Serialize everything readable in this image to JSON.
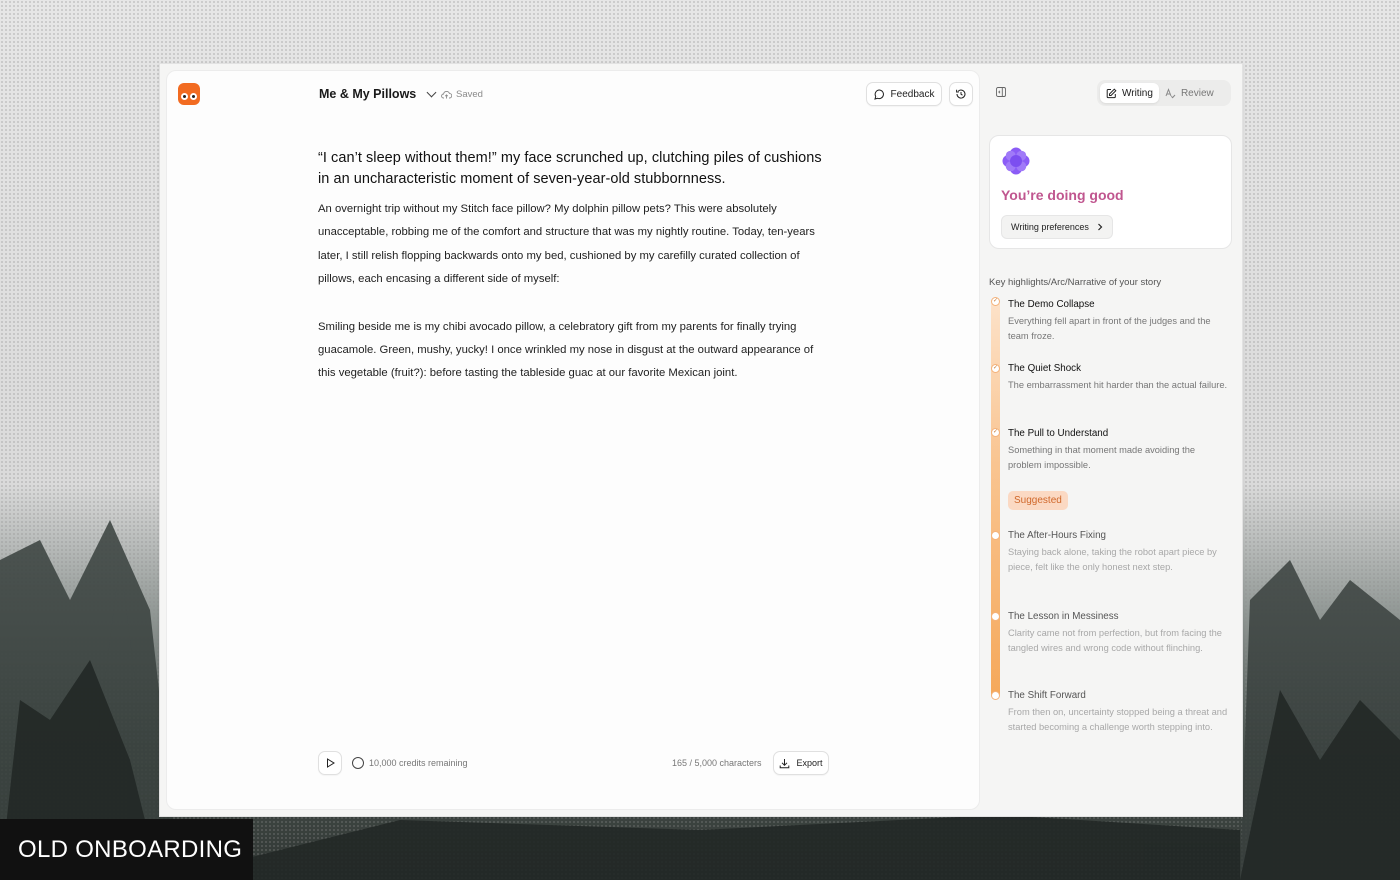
{
  "header": {
    "doc_title": "Me & My Pillows",
    "save_status": "Saved",
    "feedback_label": "Feedback"
  },
  "document": {
    "heading": "“I can’t sleep without them!” my face scrunched up, clutching piles of cushions in an uncharacteristic moment of seven-year-old stubbornness.",
    "paragraphs": [
      "An overnight trip without my Stitch face pillow? My dolphin pillow pets?  This were absolutely unacceptable, robbing me of the comfort and structure that was my nightly routine. Today, ten-years later, I still relish flopping backwards onto my bed, cushioned by my carefilly curated collection of pillows, each encasing a different side of myself:",
      "Smiling beside me is my chibi avocado pillow, a celebratory gift from my parents for finally trying guacamole. Green, mushy, yucky! I once wrinkled my nose in disgust at the outward appearance of this vegetable (fruit?): before tasting the tableside guac at our favorite Mexican joint."
    ]
  },
  "footer": {
    "credits": "10,000 credits remaining",
    "char_count": "165 / 5,000 characters",
    "export_label": "Export"
  },
  "sidebar": {
    "tabs": [
      {
        "label": "Writing",
        "active": true,
        "icon": "edit-icon"
      },
      {
        "label": "Review",
        "active": false,
        "icon": "review-icon"
      }
    ],
    "status_title": "You’re doing good",
    "preferences_label": "Writing preferences",
    "highlights_title": "Key highlights/Arc/Narrative of your story",
    "suggested_label": "Suggested",
    "completed_items": [
      {
        "title": "The Demo Collapse",
        "desc": "Everything fell apart in front of the judges and the team froze."
      },
      {
        "title": "The Quiet Shock",
        "desc": "The embarrassment hit harder than the actual failure."
      },
      {
        "title": "The Pull to Understand",
        "desc": "Something in that moment made avoiding the problem impossible."
      }
    ],
    "suggested_items": [
      {
        "title": "The After-Hours Fixing",
        "desc": "Staying back alone, taking the robot apart piece by piece, felt like the only honest next step."
      },
      {
        "title": "The Lesson in Messiness",
        "desc": "Clarity came not from perfection, but from facing the tangled wires and wrong code without flinching."
      },
      {
        "title": "The Shift Forward",
        "desc": "From then on, uncertainty stopped being a threat and started becoming a challenge worth stepping into."
      }
    ]
  },
  "overlay_label": "OLD ONBOARDING",
  "colors": {
    "accent": "#f26b21",
    "status_title": "#c0568f",
    "flower": "#8b5cf6",
    "suggested_bg": "#fbd9c3",
    "suggested_text": "#d0682b"
  }
}
